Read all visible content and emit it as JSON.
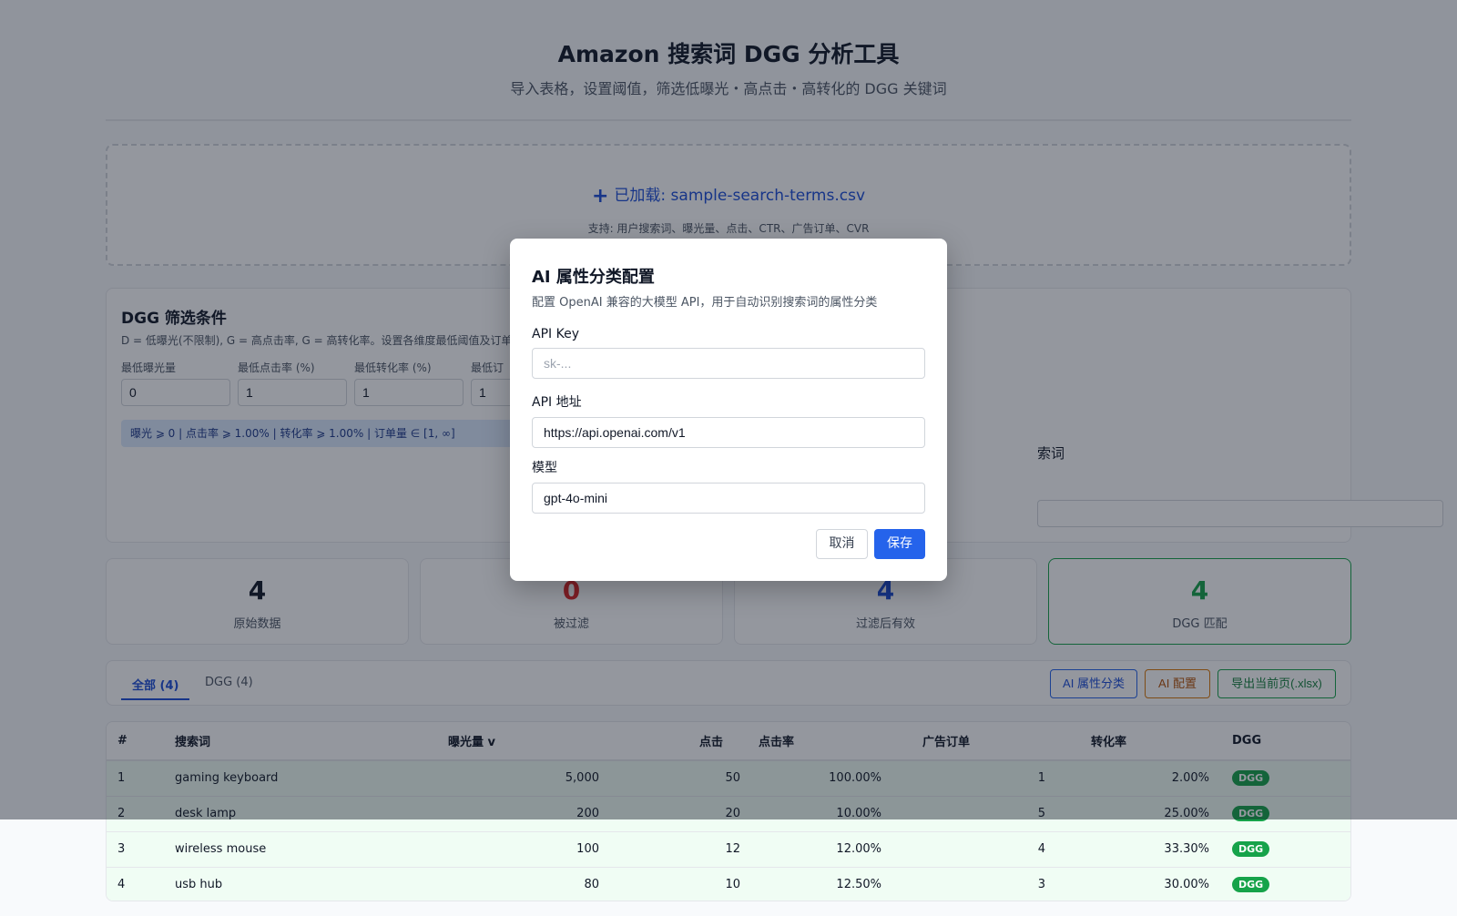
{
  "header": {
    "title": "Amazon 搜索词 DGG 分析工具",
    "subtitle": "导入表格，设置阈值，筛选低曝光・高点击・高转化的 DGG 关键词"
  },
  "upload": {
    "loaded_text": "已加载: sample-search-terms.csv",
    "support_text": "支持: 用户搜索词、曝光量、点击、CTR、广告订单、CVR",
    "icon": "plus-icon"
  },
  "filters": {
    "title": "DGG 筛选条件",
    "description": "D = 低曝光(不限制), G = 高点击率, G = 高转化率。设置各维度最低阈值及订单量范",
    "fields": [
      {
        "label": "最低曝光量",
        "value": "0"
      },
      {
        "label": "最低点击率 (%)",
        "value": "1"
      },
      {
        "label": "最低转化率 (%)",
        "value": "1"
      },
      {
        "label": "最低订",
        "value": "1"
      }
    ],
    "summary": "曝光 ⩾ 0 | 点击率 ⩾ 1.00% | 转化率 ⩾ 1.00% | 订单量 ∈ [1, ∞]",
    "right_text": "索词"
  },
  "stats": [
    {
      "value": "4",
      "label": "原始数据",
      "color": "#111827"
    },
    {
      "value": "0",
      "label": "被过滤",
      "color": "#dc2626"
    },
    {
      "value": "4",
      "label": "过滤后有效",
      "color": "#1d4ed8"
    },
    {
      "value": "4",
      "label": "DGG 匹配",
      "color": "#16a34a"
    }
  ],
  "tabs": [
    {
      "label": "全部 (4)",
      "active": true
    },
    {
      "label": "DGG (4)",
      "active": false
    }
  ],
  "toolbar": {
    "ai_classify": "AI 属性分类",
    "ai_config": "AI 配置",
    "export": "导出当前页(.xlsx)"
  },
  "table": {
    "headers": [
      "#",
      "搜索词",
      "曝光量 v",
      "点击",
      "点击率",
      "广告订单",
      "转化率",
      "DGG"
    ],
    "rows": [
      {
        "idx": "1",
        "term": "gaming keyboard",
        "impressions": "5,000",
        "clicks": "50",
        "ctr": "100.00%",
        "orders": "1",
        "cvr": "2.00%",
        "dgg": "DGG"
      },
      {
        "idx": "2",
        "term": "desk lamp",
        "impressions": "200",
        "clicks": "20",
        "ctr": "10.00%",
        "orders": "5",
        "cvr": "25.00%",
        "dgg": "DGG"
      },
      {
        "idx": "3",
        "term": "wireless mouse",
        "impressions": "100",
        "clicks": "12",
        "ctr": "12.00%",
        "orders": "4",
        "cvr": "33.30%",
        "dgg": "DGG"
      },
      {
        "idx": "4",
        "term": "usb hub",
        "impressions": "80",
        "clicks": "10",
        "ctr": "12.50%",
        "orders": "3",
        "cvr": "30.00%",
        "dgg": "DGG"
      }
    ]
  },
  "modal": {
    "title": "AI 属性分类配置",
    "description": "配置 OpenAI 兼容的大模型 API，用于自动识别搜索词的属性分类",
    "api_key": {
      "label": "API Key",
      "value": "",
      "placeholder": "sk-..."
    },
    "api_url": {
      "label": "API 地址",
      "value": "https://api.openai.com/v1"
    },
    "model": {
      "label": "模型",
      "value": "gpt-4o-mini"
    },
    "cancel": "取消",
    "save": "保存"
  }
}
